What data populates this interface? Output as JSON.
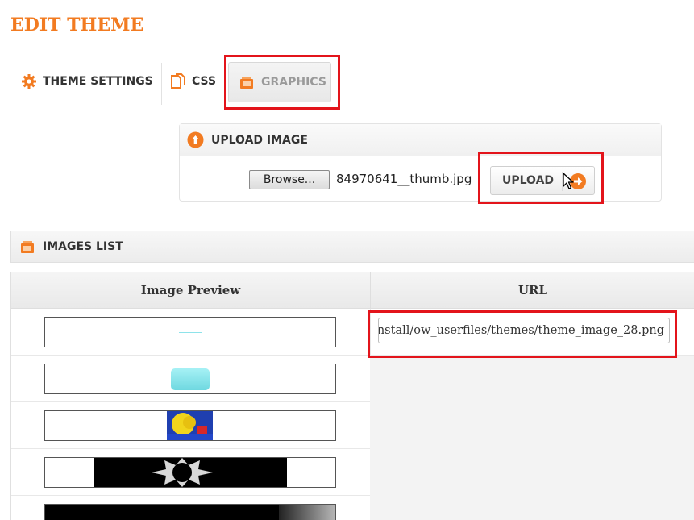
{
  "page": {
    "title": "EDIT THEME"
  },
  "tabs": [
    {
      "label": "THEME SETTINGS",
      "icon": "gear-icon",
      "active": false
    },
    {
      "label": "CSS",
      "icon": "file-copy-icon",
      "active": false
    },
    {
      "label": "GRAPHICS",
      "icon": "images-icon",
      "active": true
    }
  ],
  "upload": {
    "header": "UPLOAD IMAGE",
    "browse_label": "Browse...",
    "file_name": "84970641__thumb.jpg",
    "upload_label": "UPLOAD"
  },
  "images_list": {
    "header": "IMAGES LIST",
    "columns": [
      "Image Preview",
      "URL"
    ],
    "rows": [
      {
        "preview": "thin-cyan-line",
        "url": "nstall/ow_userfiles/themes/theme_image_28.png"
      },
      {
        "preview": "cyan-rounded-button",
        "url": ""
      },
      {
        "preview": "yellow-blue-photo",
        "url": ""
      },
      {
        "preview": "black-star-graphic",
        "url": ""
      },
      {
        "preview": "dark-photo",
        "url": ""
      }
    ]
  },
  "colors": {
    "accent": "#f27b21",
    "highlight": "#e3141b"
  }
}
